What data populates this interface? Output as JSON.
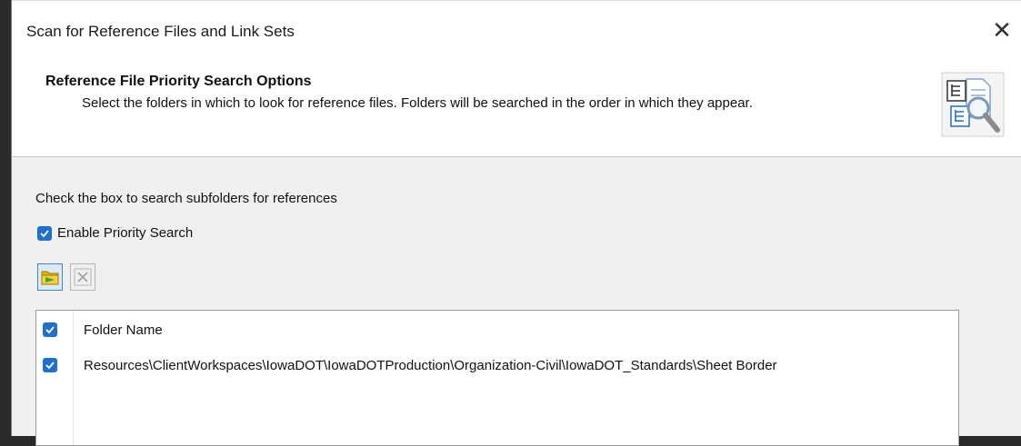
{
  "window": {
    "title": "Scan for Reference Files and Link Sets",
    "close_symbol": "✕"
  },
  "header": {
    "title": "Reference File Priority Search Options",
    "subtitle": "Select the folders in which to look for reference files.  Folders will be searched in the order in which they appear.",
    "icon": "folder-tree-search-icon"
  },
  "content": {
    "instruction": "Check the box to search subfolders for references",
    "enable_priority_search": {
      "label": "Enable Priority Search",
      "checked": true
    },
    "toolbar": {
      "add_icon": "add-folder-icon",
      "remove_icon": "remove-icon"
    },
    "folder_list": {
      "header": {
        "label": "Folder Name",
        "checked": true
      },
      "rows": [
        {
          "path": "Resources\\ClientWorkspaces\\IowaDOT\\IowaDOTProduction\\Organization-Civil\\IowaDOT_Standards\\Sheet Border",
          "checked": true
        }
      ]
    }
  },
  "colors": {
    "accent": "#1e6fd0",
    "dialog_bg": "#f0f0f0",
    "header_bg": "#ffffff"
  }
}
